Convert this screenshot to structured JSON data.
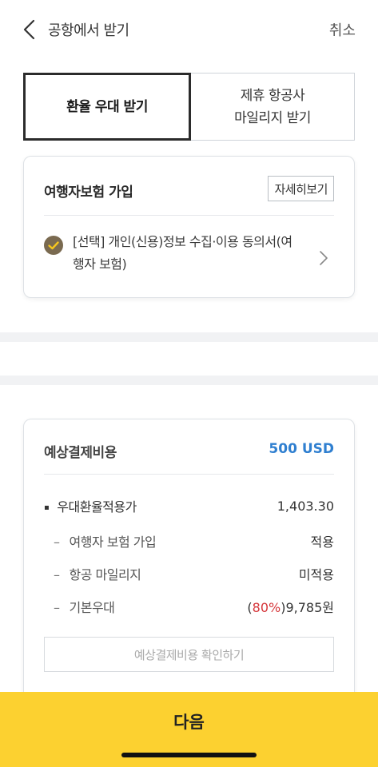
{
  "header": {
    "title": "공항에서 받기",
    "cancel_label": "취소"
  },
  "tabs": [
    {
      "label": "환율 우대 받기",
      "active": true
    },
    {
      "label": "제휴 항공사\n마일리지 받기",
      "active": false
    }
  ],
  "insurance": {
    "title": "여행자보험 가입",
    "detail_label": "자세히보기",
    "consent_text": "[선택] 개인(신용)정보 수집·이용 동의서(여행자 보험)",
    "checked": true
  },
  "cost": {
    "title": "예상결제비용",
    "amount": "500 USD",
    "rows": [
      {
        "label": "우대환율적용가",
        "value": "1,403.30"
      },
      {
        "label": "여행자 보험 가입",
        "value": "적용"
      },
      {
        "label": "항공 마일리지",
        "value": "미적용"
      },
      {
        "label": "기본우대",
        "value_prefix": "(",
        "value_highlight": "80%",
        "value_suffix": ")9,785원"
      }
    ],
    "confirm_label": "예상결제비용 확인하기"
  },
  "next_label": "다음",
  "colors": {
    "accent_blue": "#2f7fd0",
    "primary_yellow": "#fcd130",
    "highlight_red": "#d6383c",
    "check_brown": "#7a6a50"
  }
}
